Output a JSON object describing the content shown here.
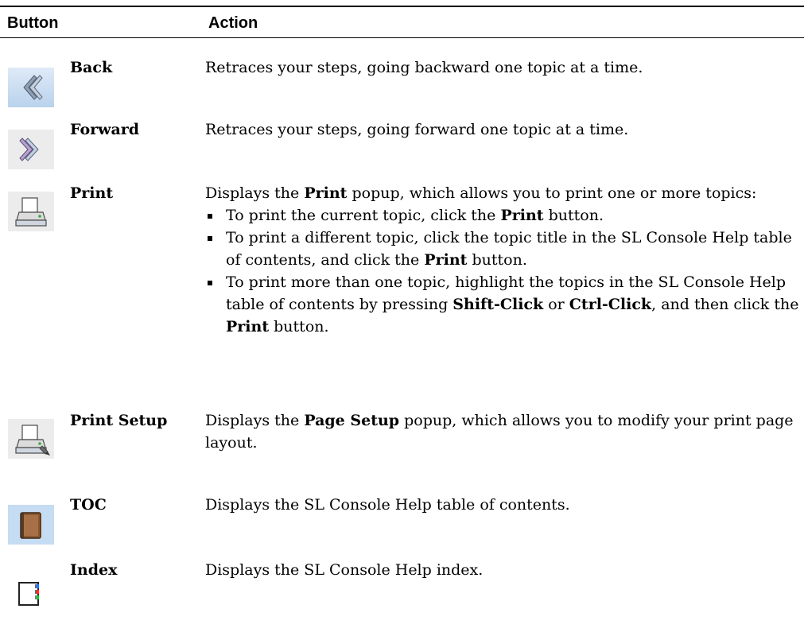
{
  "header": {
    "button": "Button",
    "action": "Action"
  },
  "rows": [
    {
      "name": "Back",
      "icon": "back-arrow-icon",
      "desc": "Retraces your steps, going backward one topic at a time."
    },
    {
      "name": "Forward",
      "icon": "forward-arrow-icon",
      "desc": "Retraces your steps, going forward one topic at a time."
    },
    {
      "name": "Print",
      "icon": "printer-icon",
      "intro": {
        "a": "Displays the ",
        "b": "Print",
        "c": " popup, which allows you to print one or more topics:"
      },
      "bullets": [
        {
          "a": "To print the current topic, click the ",
          "b": "Print",
          "c": " button."
        },
        {
          "a": "To print a different topic, click the topic title in the SL Console Help table of contents, and click the ",
          "b": "Print",
          "c": " button."
        },
        {
          "a": "To print more than one topic, highlight the topics in the SL Console Help table of contents by pressing ",
          "b": "Shift-Click",
          "c": " or ",
          "d": "Ctrl-Click",
          "e": ", and then click the ",
          "f": "Print",
          "g": " button."
        }
      ]
    },
    {
      "name": "Print Setup",
      "icon": "print-setup-icon",
      "intro": {
        "a": "Displays the ",
        "b": "Page Setup",
        "c": " popup, which allows you to modify your print page layout."
      }
    },
    {
      "name": "TOC",
      "icon": "book-icon",
      "desc": "Displays the SL Console Help table of contents."
    },
    {
      "name": "Index",
      "icon": "index-icon",
      "desc": "Displays the SL Console Help index."
    }
  ],
  "colors": {
    "rule": "#000000",
    "icon_bg_active": "#c6dcf2",
    "icon_bg_plain": "#ececec"
  }
}
